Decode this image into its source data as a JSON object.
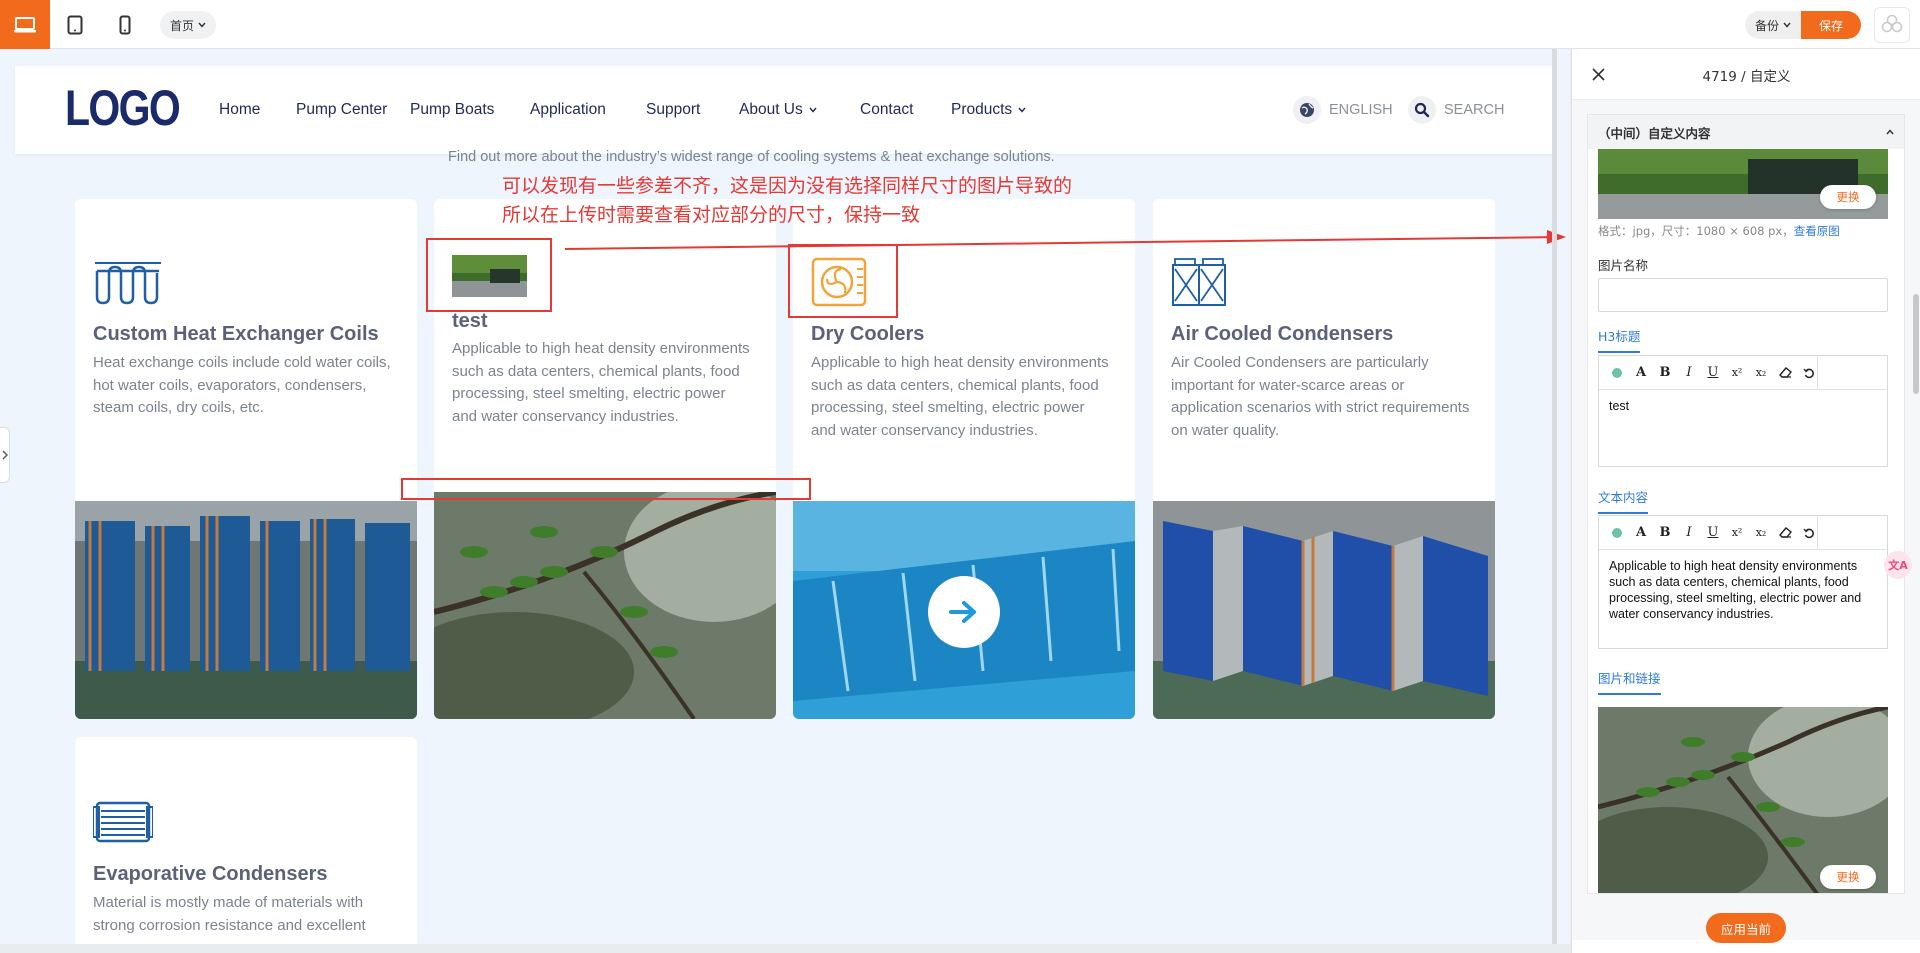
{
  "toolbar": {
    "devices": [
      "desktop-icon",
      "tablet-icon",
      "mobile-icon"
    ],
    "page_select": "首页",
    "backup_label": "备份",
    "save_label": "保存",
    "accent_color": "#f26b1d"
  },
  "site": {
    "logo": "LOGO",
    "nav": [
      {
        "label": "Home",
        "dropdown": false
      },
      {
        "label": "Pump Center",
        "dropdown": false
      },
      {
        "label": "Pump Boats",
        "dropdown": false
      },
      {
        "label": "Application",
        "dropdown": false
      },
      {
        "label": "Support",
        "dropdown": false
      },
      {
        "label": "About Us",
        "dropdown": true
      },
      {
        "label": "Contact",
        "dropdown": false
      },
      {
        "label": "Products",
        "dropdown": true
      }
    ],
    "language": "ENGLISH",
    "search": "SEARCH",
    "intro": "Find out more about the industry’s widest range of cooling systems & heat exchange solutions."
  },
  "cards": [
    {
      "title": "Custom Heat Exchanger Coils",
      "text": "Heat exchange coils include cold water coils, hot water coils, evaporators, condensers, steam coils, dry coils, etc.",
      "icon": "coil-icon"
    },
    {
      "title": "test",
      "text": "Applicable to high heat density environments such as data centers, chemical plants, food processing, steel smelting, electric power and water conservancy industries.",
      "icon": "thumbnail-image"
    },
    {
      "title": "Dry Coolers",
      "text": "Applicable to high heat density environments such as data centers, chemical plants, food processing, steel smelting, electric power and water conservancy industries.",
      "icon": "fan-icon"
    },
    {
      "title": "Air Cooled Condensers",
      "text": "Air Cooled Condensers are particularly important for water-scarce areas or application scenarios with strict requirements on water quality.",
      "icon": "condenser-icon"
    },
    {
      "title": "Evaporative Condensers",
      "text": "Material is mostly made of materials with strong corrosion resistance and excellent",
      "icon": "radiator-icon"
    }
  ],
  "annotation": {
    "line1": "可以发现有一些参差不齐，这是因为没有选择同样尺寸的图片导致的",
    "line2": "所以在上传时需要查看对应部分的尺寸，保持一致",
    "color": "#e53935"
  },
  "panel": {
    "title": "4719 / 自定义",
    "section_title": "（中间）自定义内容",
    "image_info": "格式：jpg，尺寸：1080 × 608 px，",
    "view_original": "查看原图",
    "change_label": "更换",
    "image_name_label": "图片名称",
    "image_name_value": "",
    "h3_tab": "H3标题",
    "h3_value": "test",
    "text_tab": "文本内容",
    "text_value": "Applicable to high heat density environments such as data centers, chemical plants, food processing, steel smelting, electric power and water conservancy industries.",
    "image_link_tab": "图片和链接",
    "change_label_2": "更换",
    "apply_label": "应用当前",
    "translate_label": "文A"
  }
}
